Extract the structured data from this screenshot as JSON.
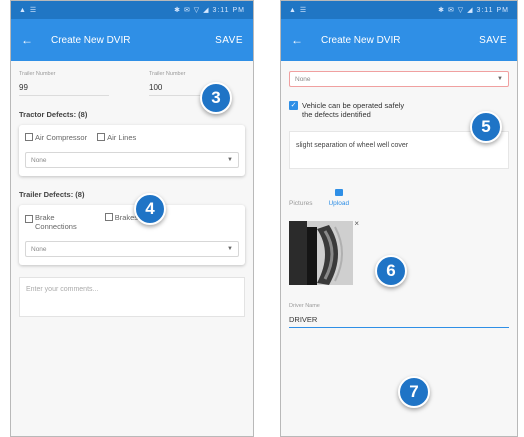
{
  "colors": {
    "primary": "#2f8fe6",
    "status_bar": "#2076c4",
    "badge": "#1f74c6"
  },
  "status_bar": {
    "left": "▲ ☰",
    "right": "✱ ✉ ▽ ◢ 3:11 PM"
  },
  "left_screen": {
    "appbar": {
      "back_icon": "arrow-left-icon",
      "title": "Create New DVIR",
      "save": "SAVE"
    },
    "fields": [
      {
        "label": "Trailer Number",
        "value": "99"
      },
      {
        "label": "Trailer Number",
        "value": "100"
      }
    ],
    "sections": [
      {
        "title": "Tractor Defects: (8)",
        "checkboxes": [
          "Air Compressor",
          "Air Lines"
        ],
        "select": "None"
      },
      {
        "title": "Trailer Defects: (8)",
        "checkboxes": [
          "Brake\nConnections",
          "Brakes"
        ],
        "select": "None"
      }
    ],
    "comments_placeholder": "Enter your comments..."
  },
  "right_screen": {
    "appbar": {
      "back_icon": "arrow-left-icon",
      "title": "Create New DVIR",
      "save": "SAVE"
    },
    "top_select": "None",
    "safe_checkbox": "Vehicle can be operated safely\nthe defects identified",
    "defects_text": "slight separation of wheel well cover",
    "pictures_label": "Pictures",
    "upload_label": "Upload",
    "name_label": "Driver Name",
    "name_value": "DRIVER"
  },
  "badges": [
    "3",
    "4",
    "5",
    "6",
    "7"
  ]
}
